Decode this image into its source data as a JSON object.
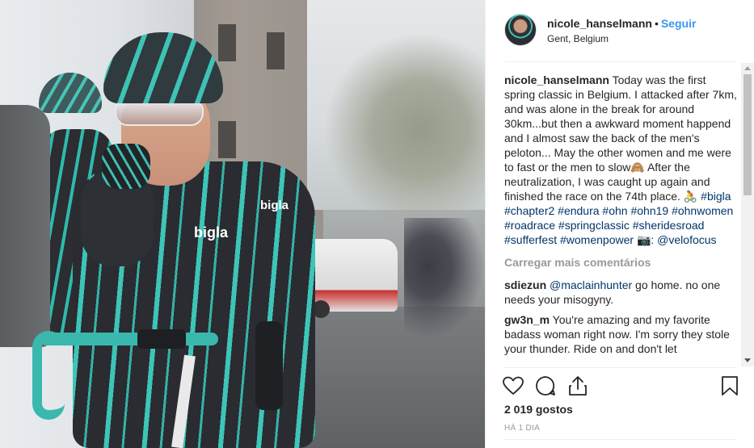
{
  "post": {
    "username": "nicole_hanselmann",
    "separator": "•",
    "follow_label": "Seguir",
    "location": "Gent, Belgium",
    "photo_alt": "bigla",
    "jersey_text": "bigla"
  },
  "caption": {
    "username": "nicole_hanselmann",
    "text": "Today was the first spring classic in Belgium. I attacked after 7km, and was alone in the break for around 30km...but then a awkward moment happend and I almost saw the back of the men's peloton... May the other women and me were to fast or the men to slow🙈 After the neutralization, I was caught up again and finished the race on the 74th place. 🚴",
    "hashtags": "#bigla #chapter2 #endura #ohn #ohn19 #ohnwomen #roadrace #springclassic #sheridesroad #sufferfest #womenpower",
    "camera_emoji": "📷",
    "photo_credit": ": @velofocus"
  },
  "load_more_label": "Carregar mais comentários",
  "comments": [
    {
      "username": "sdiezun",
      "mention": "@maclainhunter",
      "text": " go home. no one needs your misogyny."
    },
    {
      "username": "gw3n_m",
      "mention": "",
      "text": "You're amazing and my favorite badass woman right now. I'm sorry they stole your thunder. Ride on and don't let"
    }
  ],
  "actions": {
    "like_icon": "heart-icon",
    "comment_icon": "comment-icon",
    "share_icon": "share-icon",
    "save_icon": "bookmark-icon"
  },
  "likes_label": "2 019 gostos",
  "timestamp": "HÁ 1 DIA",
  "colors": {
    "link_blue": "#3897f0",
    "hashtag": "#003569",
    "muted": "#999999",
    "text": "#262626"
  }
}
